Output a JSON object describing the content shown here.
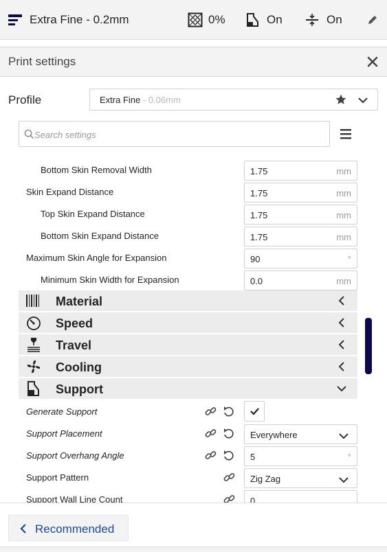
{
  "topbar": {
    "profile_name": "Extra Fine - 0.2mm",
    "infill_value": "0%",
    "support_value": "On",
    "adhesion_value": "On"
  },
  "panel": {
    "title": "Print settings"
  },
  "profile": {
    "label": "Profile",
    "name": "Extra Fine",
    "subtitle": "- 0.06mm"
  },
  "search": {
    "placeholder": "Search settings"
  },
  "settings": [
    {
      "label": "Bottom Skin Removal Width",
      "value": "1.75",
      "unit": "mm"
    },
    {
      "label": "Skin Expand Distance",
      "value": "1.75",
      "unit": "mm"
    },
    {
      "label": "Top Skin Expand Distance",
      "value": "1.75",
      "unit": "mm"
    },
    {
      "label": "Bottom Skin Expand Distance",
      "value": "1.75",
      "unit": "mm"
    },
    {
      "label": "Maximum Skin Angle for Expansion",
      "value": "90",
      "unit": "°"
    },
    {
      "label": "Minimum Skin Width for Expansion",
      "value": "0.0",
      "unit": "mm"
    }
  ],
  "categories": [
    {
      "label": "Material",
      "icon": "material-icon"
    },
    {
      "label": "Speed",
      "icon": "speed-icon"
    },
    {
      "label": "Travel",
      "icon": "travel-icon"
    },
    {
      "label": "Cooling",
      "icon": "cooling-icon"
    },
    {
      "label": "Support",
      "icon": "support-icon"
    }
  ],
  "support_settings": [
    {
      "label": "Generate Support",
      "value": "",
      "unit": ""
    },
    {
      "label": "Support Placement",
      "value": "Everywhere",
      "unit": ""
    },
    {
      "label": "Support Overhang Angle",
      "value": "5",
      "unit": "°"
    },
    {
      "label": "Support Pattern",
      "value": "Zig Zag",
      "unit": ""
    },
    {
      "label": "Support Wall Line Count",
      "value": "0",
      "unit": ""
    }
  ],
  "footer": {
    "recommended_label": "Recommended"
  },
  "colors": {
    "accent": "#1a4a9a",
    "scrollbar": "#0a0a52",
    "category_bg": "#ececec"
  }
}
